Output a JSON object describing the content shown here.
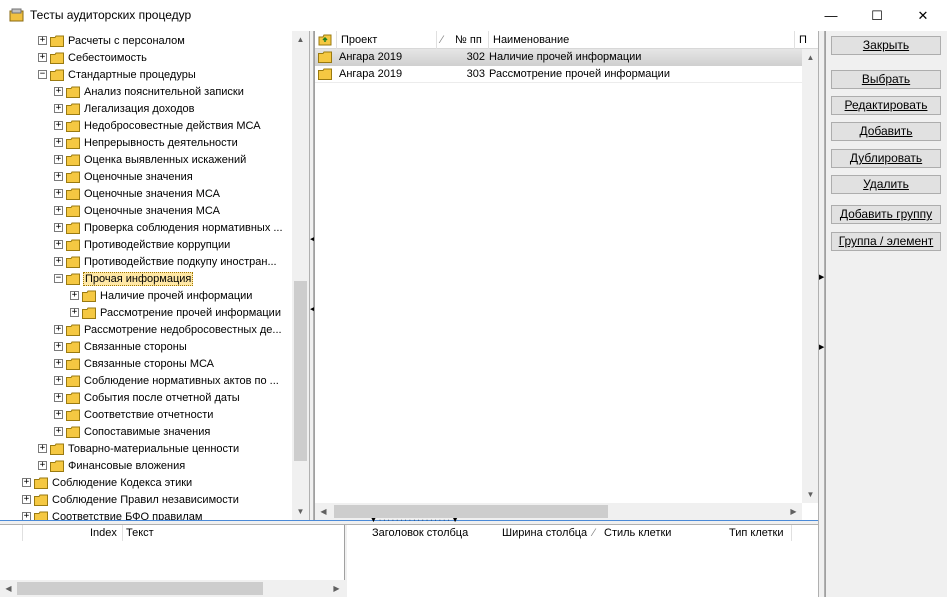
{
  "window": {
    "title": "Тесты аудиторских процедур",
    "minimize": "—",
    "maximize": "☐",
    "close": "✕"
  },
  "tree": {
    "items": [
      {
        "label": "Расчеты с персоналом",
        "level": 2,
        "expander": "+"
      },
      {
        "label": "Себестоимость",
        "level": 2,
        "expander": "+"
      },
      {
        "label": "Стандартные процедуры",
        "level": 2,
        "expander": "−"
      },
      {
        "label": "Анализ пояснительной записки",
        "level": 3,
        "expander": "+"
      },
      {
        "label": "Легализация доходов",
        "level": 3,
        "expander": "+"
      },
      {
        "label": "Недобросовестные действия МСА",
        "level": 3,
        "expander": "+"
      },
      {
        "label": "Непрерывность деятельности",
        "level": 3,
        "expander": "+"
      },
      {
        "label": "Оценка выявленных искажений",
        "level": 3,
        "expander": "+"
      },
      {
        "label": "Оценочные значения",
        "level": 3,
        "expander": "+"
      },
      {
        "label": "Оценочные значения МСА",
        "level": 3,
        "expander": "+"
      },
      {
        "label": "Оценочные значения МСА",
        "level": 3,
        "expander": "+"
      },
      {
        "label": "Проверка соблюдения нормативных ...",
        "level": 3,
        "expander": "+"
      },
      {
        "label": "Противодействие коррупции",
        "level": 3,
        "expander": "+"
      },
      {
        "label": "Противодействие подкупу иностран...",
        "level": 3,
        "expander": "+"
      },
      {
        "label": "Прочая информация",
        "level": 3,
        "expander": "−",
        "selected": true
      },
      {
        "label": "Наличие прочей информации",
        "level": 4,
        "expander": "+"
      },
      {
        "label": "Рассмотрение прочей информации",
        "level": 4,
        "expander": "+"
      },
      {
        "label": "Рассмотрение недобросовестных де...",
        "level": 3,
        "expander": "+"
      },
      {
        "label": "Связанные стороны",
        "level": 3,
        "expander": "+"
      },
      {
        "label": "Связанные стороны МСА",
        "level": 3,
        "expander": "+"
      },
      {
        "label": "Соблюдение нормативных актов по ...",
        "level": 3,
        "expander": "+"
      },
      {
        "label": "События после отчетной даты",
        "level": 3,
        "expander": "+"
      },
      {
        "label": "Соответствие отчетности",
        "level": 3,
        "expander": "+"
      },
      {
        "label": "Сопоставимые значения",
        "level": 3,
        "expander": "+"
      },
      {
        "label": "Товарно-материальные ценности",
        "level": 2,
        "expander": "+"
      },
      {
        "label": "Финансовые вложения",
        "level": 2,
        "expander": "+"
      },
      {
        "label": "Соблюдение Кодекса этики",
        "level": 1,
        "expander": "+"
      },
      {
        "label": "Соблюдение Правил независимости",
        "level": 1,
        "expander": "+"
      },
      {
        "label": "Соответствие БФО правилам",
        "level": 1,
        "expander": "+"
      }
    ]
  },
  "grid": {
    "columns": {
      "project": "Проект",
      "sort_mark": "⁄",
      "number": "№ пп",
      "name": "Наименование",
      "extra": "П"
    },
    "rows": [
      {
        "project": "Ангара 2019",
        "number": "302",
        "name": "Наличие прочей информации",
        "selected": true
      },
      {
        "project": "Ангара 2019",
        "number": "303",
        "name": "Рассмотрение прочей информации",
        "selected": false
      }
    ]
  },
  "buttons": {
    "close": "Закрыть",
    "select": "Выбрать",
    "edit": "Редактировать",
    "add": "Добавить",
    "duplicate": "Дублировать",
    "delete": "Удалить",
    "add_group": "Добавить группу",
    "group_element": "Группа / элемент"
  },
  "bottom_left": {
    "index_col": "Index",
    "text_col": "Текст"
  },
  "bottom_right": {
    "col_header": "Заголовок столбца",
    "col_width": "Ширина столбца",
    "sort_mark": "⁄",
    "cell_style": "Стиль клетки",
    "cell_type": "Тип клетки"
  },
  "colors": {
    "folder": "#f5c842",
    "selection": "#ffe8a6",
    "splitter_accent": "#4a8ad8"
  }
}
